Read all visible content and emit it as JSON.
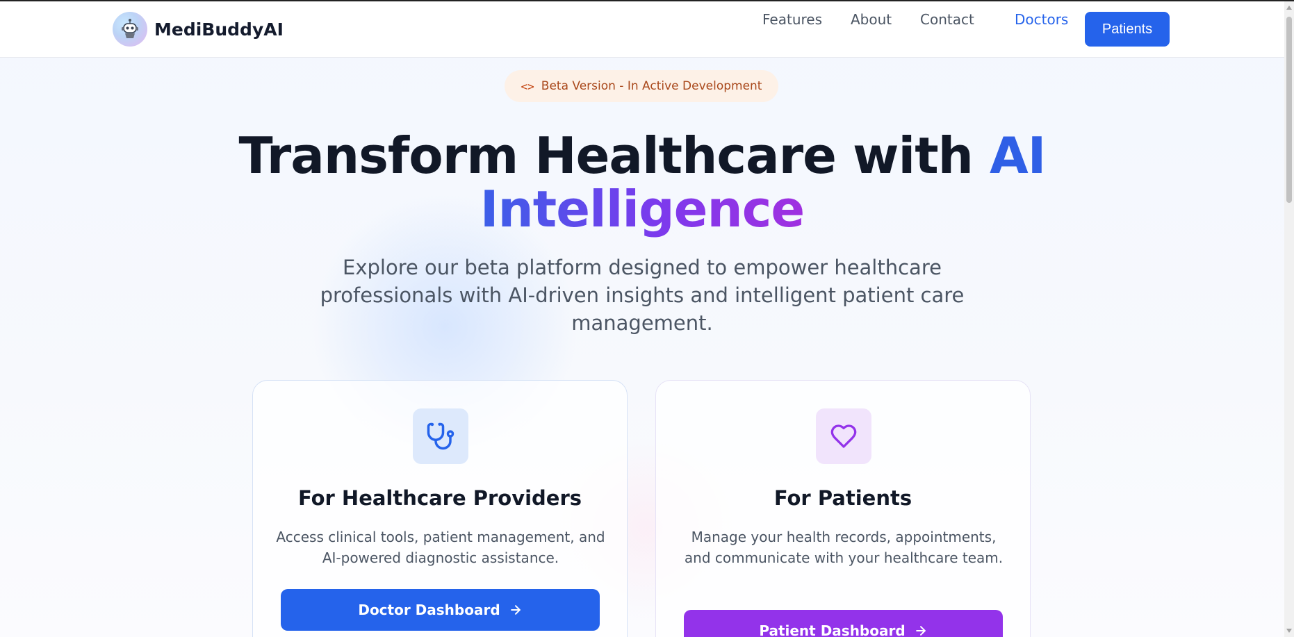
{
  "brand": {
    "name": "MediBuddyAI"
  },
  "nav": {
    "links": [
      "Features",
      "About",
      "Contact"
    ],
    "doctors_label": "Doctors",
    "patients_label": "Patients"
  },
  "beta_badge": {
    "icon": "<>",
    "label": "Beta Version - In Active Development"
  },
  "hero": {
    "title_part1": "Transform Healthcare with ",
    "title_part2": "AI",
    "title_part3": "Intelligence",
    "subtitle": "Explore our beta platform designed to empower healthcare professionals with AI-driven insights and intelligent patient care management."
  },
  "cards": [
    {
      "icon": "stethoscope-icon",
      "title": "For Healthcare Providers",
      "description": "Access clinical tools, patient management, and AI-powered diagnostic assistance.",
      "button": "Doctor Dashboard"
    },
    {
      "icon": "heart-icon",
      "title": "For Patients",
      "description": "Manage your health records, appointments, and communicate with your healthcare team.",
      "button": "Patient Dashboard"
    }
  ],
  "colors": {
    "primary": "#2563eb",
    "purple": "#9333ea",
    "badge_bg": "#fdf1e7",
    "badge_text": "#a9481b"
  }
}
